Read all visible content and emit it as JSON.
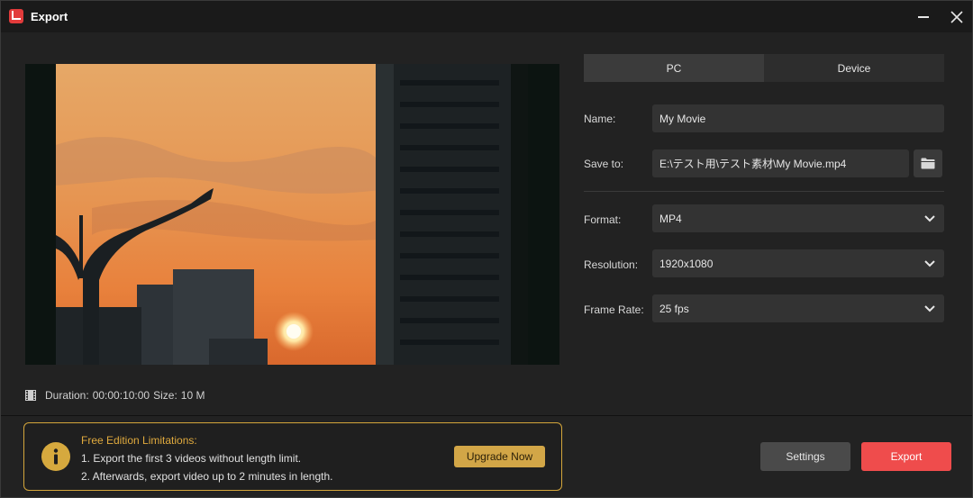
{
  "window": {
    "title": "Export",
    "icon": "app-logo-icon"
  },
  "preview": {
    "duration_label": "Duration:",
    "duration_value": "00:00:10:00",
    "size_label": "Size:",
    "size_value": "10 M"
  },
  "tabs": [
    {
      "label": "PC",
      "active": true
    },
    {
      "label": "Device",
      "active": false
    }
  ],
  "form": {
    "name_label": "Name:",
    "name_value": "My Movie",
    "save_to_label": "Save to:",
    "save_to_value": "E:\\テスト用\\テスト素材\\My Movie.mp4",
    "format_label": "Format:",
    "format_value": "MP4",
    "resolution_label": "Resolution:",
    "resolution_value": "1920x1080",
    "frame_rate_label": "Frame Rate:",
    "frame_rate_value": "25 fps"
  },
  "notice": {
    "title": "Free Edition Limitations:",
    "line1": "1. Export the first 3 videos without length limit.",
    "line2": "2. Afterwards, export video up to 2 minutes in length.",
    "upgrade_label": "Upgrade Now"
  },
  "actions": {
    "settings_label": "Settings",
    "export_label": "Export"
  },
  "colors": {
    "accent_red": "#ef4c4c",
    "notice_gold": "#d6a93e",
    "panel_bg": "#222222"
  }
}
